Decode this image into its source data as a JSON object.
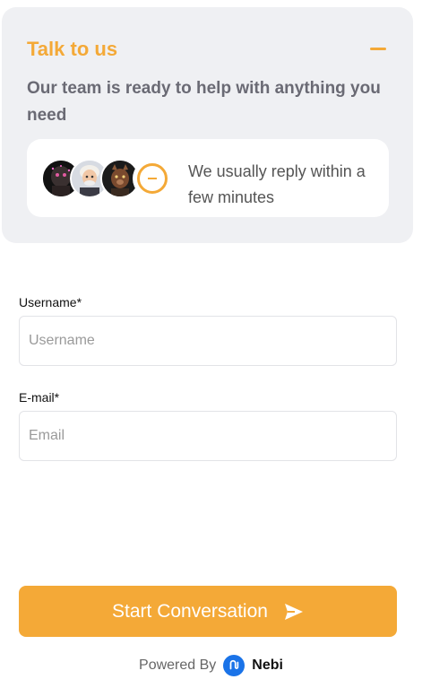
{
  "header": {
    "title": "Talk to us",
    "subtitle": "Our team is ready to help with anything you need",
    "reply_time": "We usually reply within a few minutes"
  },
  "form": {
    "username": {
      "label": "Username*",
      "placeholder": "Username",
      "value": ""
    },
    "email": {
      "label": "E-mail*",
      "placeholder": "Email",
      "value": ""
    }
  },
  "actions": {
    "start_label": "Start Conversation"
  },
  "footer": {
    "powered_by": "Powered By",
    "brand": "Nebi"
  },
  "colors": {
    "accent": "#f4a937",
    "panel": "#eff0f3",
    "brand": "#1a73e8"
  },
  "icons": {
    "minimize": "minus-icon",
    "clock": "clock-icon",
    "send": "send-icon",
    "brand": "nebi-logo-icon"
  }
}
